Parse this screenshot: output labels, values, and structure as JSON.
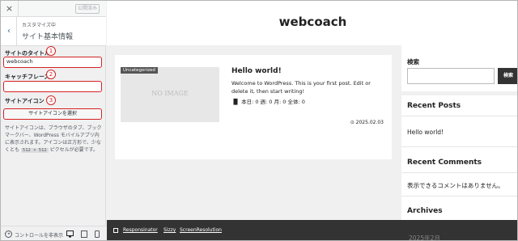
{
  "customizer": {
    "close_icon": "×",
    "publish_label": "公開済み",
    "back_icon": "‹",
    "breadcrumb": "カスタマイズ中",
    "section_title": "サイト基本情報"
  },
  "fields": {
    "site_title_label": "サイトのタイトル",
    "site_title_value": "webcoach",
    "tagline_label": "キャッチフレーズ",
    "tagline_value": "",
    "site_icon_label": "サイトアイコン",
    "select_icon_button": "サイトアイコンを選択",
    "site_icon_desc_1": "サイトアイコンは、ブラウザのタブ、ブックマークバー、WordPress モバイルアプリ内に表示されます。アイコンは正方形で、少なくとも ",
    "site_icon_desc_code": "512 × 512",
    "site_icon_desc_2": " ピクセルが必要です。"
  },
  "annotations": {
    "badge_1": "1",
    "badge_2": "2",
    "badge_3": "3"
  },
  "footer": {
    "hide_controls_label": "コントロールを非表示",
    "device_desktop_icon": "🖥",
    "device_tablet_icon": "▯",
    "device_mobile_icon": "▯"
  },
  "preview": {
    "site_title": "webcoach",
    "post": {
      "category_badge": "Uncategorized",
      "thumbnail_text": "NO IMAGE",
      "title": "Hello world!",
      "excerpt": "Welcome to WordPress. This is your first post. Edit or delete it, then start writing!",
      "stats": "本日: 0  週: 0  月: 0  全体: 0",
      "date": "⊙ 2025.02.03"
    },
    "widgets": {
      "search_title": "検索",
      "search_button": "検索",
      "recent_posts_title": "Recent Posts",
      "recent_post_1": "Hello world!",
      "recent_comments_title": "Recent Comments",
      "no_comments": "表示できるコメントはありません。",
      "archives_title": "Archives",
      "archive_1": "2025年2月"
    },
    "responsive_bar": {
      "item_1": "Responsinator",
      "item_2": "Sizzy",
      "item_3": "ScreenResolution"
    }
  },
  "colors": {
    "annotation_red": "#d62022",
    "wp_blue": "#2271b1",
    "bar_dark": "#333333"
  }
}
